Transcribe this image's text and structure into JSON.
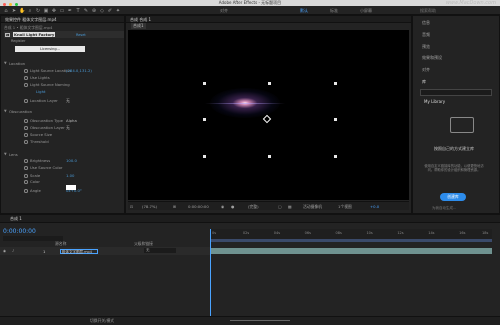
{
  "app": {
    "title": "Adobe After Effects - 无标题项目",
    "watermark": "www.MacDown.com"
  },
  "toolbar": {
    "workspaces": [
      {
        "label": "对齐",
        "active": false
      },
      {
        "label": "默认",
        "active": true
      },
      {
        "label": "标准",
        "active": false
      },
      {
        "label": "小屏幕",
        "active": false
      }
    ],
    "search_placeholder": "搜索帮助"
  },
  "effect_controls": {
    "tab_label": "效果控件 粗体文字图层.mp4",
    "layer_label": "合成 1 • 粗体文字图层.mp4",
    "effect_name": "Knoll Light Factory",
    "reset_label": "Reset",
    "licensing_label": "Licensing...",
    "rows": [
      {
        "label": "Location",
        "value": "",
        "indent": 0
      },
      {
        "label": "Light Source Location",
        "value": "(284.0,131.2)",
        "indent": 2
      },
      {
        "label": "Use Lights",
        "value": "",
        "indent": 2
      },
      {
        "label": "Light Source Naming",
        "value": "",
        "indent": 2
      },
      {
        "label": "Light",
        "value": "",
        "indent": 3
      },
      {
        "label": "Location Layer",
        "value": "无",
        "indent": 2
      },
      {
        "label": "Obscuration",
        "value": "",
        "indent": 0
      },
      {
        "label": "Obscuration Type",
        "value": "Alpha",
        "indent": 2
      },
      {
        "label": "Obscuration Layer",
        "value": "无",
        "indent": 2
      },
      {
        "label": "Source Size",
        "value": "",
        "indent": 2
      },
      {
        "label": "Threshold",
        "value": "",
        "indent": 2
      },
      {
        "label": "Lens",
        "value": "",
        "indent": 0
      },
      {
        "label": "Brightness",
        "value": "100.0",
        "indent": 2
      },
      {
        "label": "Use Source Color",
        "value": "",
        "indent": 2
      },
      {
        "label": "Scale",
        "value": "1.00",
        "indent": 2
      },
      {
        "label": "Color",
        "value": "",
        "indent": 2
      },
      {
        "label": "Angle",
        "value": "0x+0.0°",
        "indent": 2
      }
    ]
  },
  "viewer": {
    "tab_label": "合成 合成 1",
    "comp_tab": "合成1",
    "zoom": "(78.7%)",
    "timecode": "0:00:00:00",
    "quality": "(完整)",
    "camera": "活动摄像机",
    "views": "1个视图"
  },
  "right_panel": {
    "items": [
      "信息",
      "音频",
      "预览",
      "效果和预设",
      "对齐",
      "库"
    ],
    "library_select": "My Library",
    "library_hint": "按照自己的方式建立库",
    "library_desc": "使用自定义链接库的功能，以便更快地访问。帮助你的设计组织和管理资源。",
    "create_button": "创建库",
    "footer": "为我自动生成..."
  },
  "timeline": {
    "tab_label": "合成 1",
    "timecode": "0:00:00:00",
    "column_source": "源名称",
    "column_parent": "父级和链接",
    "layer_number": "1",
    "layer_name": "粗体文字图层.mp4",
    "parent_value": "无",
    "ruler": [
      "0s",
      "02s",
      "04s",
      "06s",
      "08s",
      "10s",
      "12s",
      "14s",
      "16s",
      "18s"
    ],
    "footer": "切换开关/模式"
  },
  "colors": {
    "accent": "#2d8ceb",
    "track": "#6f9290",
    "panel": "#232323"
  }
}
